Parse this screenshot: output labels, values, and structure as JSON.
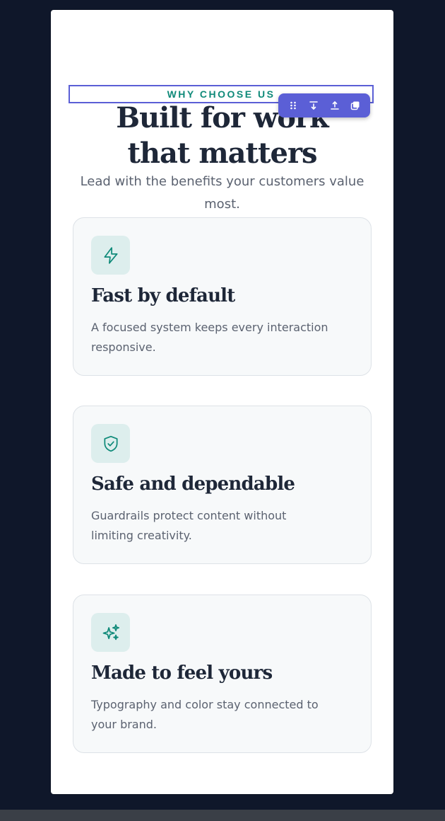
{
  "section": {
    "eyebrow": "WHY CHOOSE US",
    "title_line1": "Built for work",
    "title_line2": "that matters",
    "subtitle": "Lead with the benefits your customers value most."
  },
  "toolbar": {
    "items": [
      {
        "icon": "drag-handle-icon"
      },
      {
        "icon": "move-down-icon"
      },
      {
        "icon": "move-up-icon"
      },
      {
        "icon": "duplicate-icon"
      }
    ]
  },
  "cards": [
    {
      "icon": "lightning-bolt-icon",
      "title": "Fast by default",
      "text": "A focused system keeps every interaction responsive."
    },
    {
      "icon": "shield-check-icon",
      "title": "Safe and dependable",
      "text": "Guardrails protect content without limiting creativity."
    },
    {
      "icon": "sparkles-icon",
      "title": "Made to feel yours",
      "text": "Typography and color stay connected to your brand."
    }
  ],
  "colors": {
    "background": "#0f172a",
    "accent": "#0f8a79",
    "selection": "#5b5fd6",
    "heading": "#1e2738",
    "body": "#5b6270"
  }
}
